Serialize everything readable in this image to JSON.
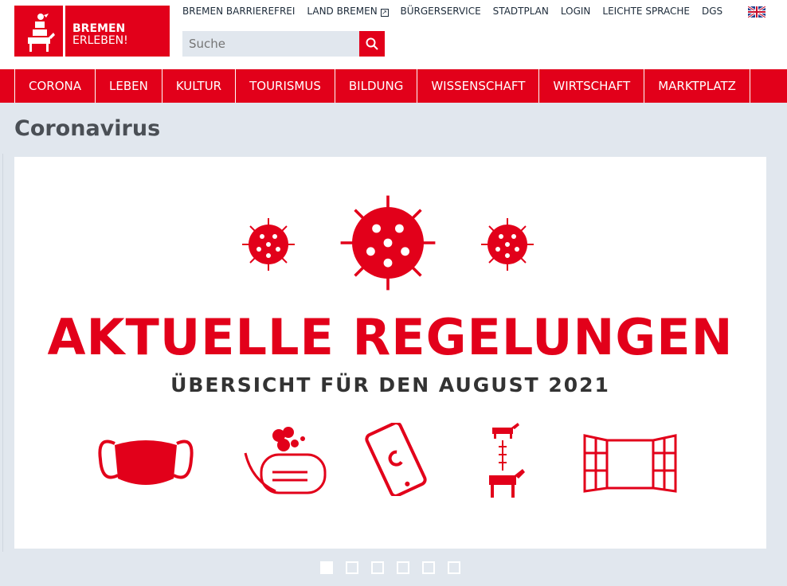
{
  "logo": {
    "line1": "BREMEN",
    "line2": "ERLEBEN!"
  },
  "top_links": [
    "BREMEN BARRIEREFREI",
    "LAND BREMEN",
    "BÜRGERSERVICE",
    "STADTPLAN",
    "LOGIN",
    "LEICHTE SPRACHE",
    "DGS"
  ],
  "search": {
    "placeholder": "Suche",
    "value": ""
  },
  "nav": [
    "CORONA",
    "LEBEN",
    "KULTUR",
    "TOURISMUS",
    "BILDUNG",
    "WISSENSCHAFT",
    "WIRTSCHAFT",
    "MARKTPLATZ"
  ],
  "page_title": "Coronavirus",
  "slide": {
    "headline": "AKTUELLE REGELUNGEN",
    "subheadline": "ÜBERSICHT FÜR DEN AUGUST 2021"
  },
  "slider": {
    "count": 6,
    "active": 1
  },
  "colors": {
    "brand": "#e2001a",
    "background": "#e1e7ee"
  }
}
